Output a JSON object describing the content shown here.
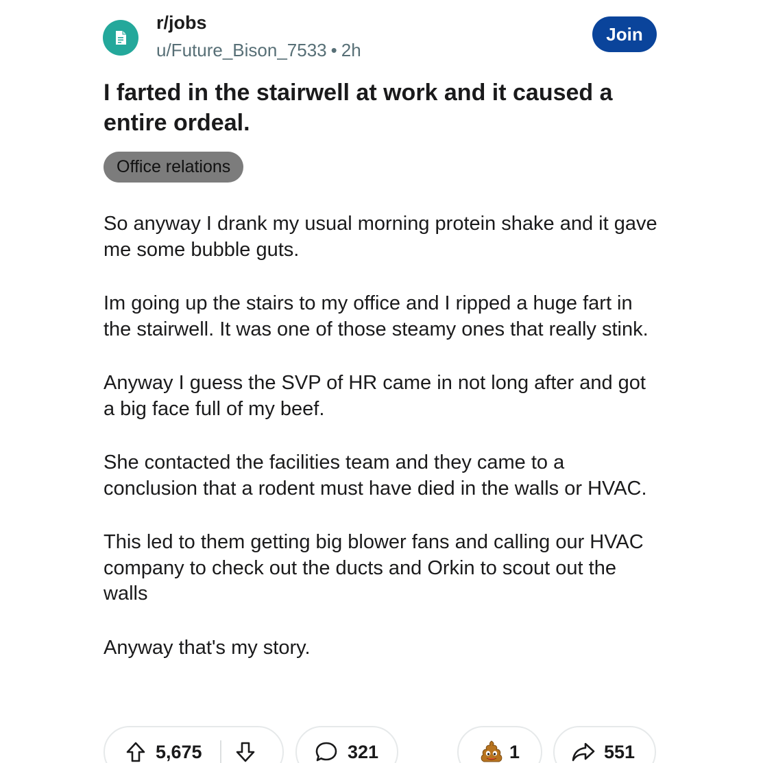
{
  "post": {
    "subreddit": "r/jobs",
    "author": "u/Future_Bison_7533",
    "separator": "•",
    "age": "2h",
    "join_label": "Join",
    "title": "I farted in the stairwell at work and it caused a entire ordeal.",
    "flair": "Office relations",
    "paragraphs": [
      "So anyway I drank my usual morning protein shake and it gave me some bubble guts.",
      "Im going up the stairs to my office and I ripped a huge fart in the stairwell. It was one of those steamy ones that really stink.",
      "Anyway I guess the SVP of HR came in not long after and got a big face full of my beef.",
      "She contacted the facilities team and they came to a conclusion that a rodent must have died in the walls or HVAC.",
      "This led to them getting big blower fans and calling our HVAC company to check out the ducts and Orkin to scout out the walls",
      "Anyway that's my story."
    ]
  },
  "actions": {
    "upvotes": "5,675",
    "comments": "321",
    "awards": "1",
    "shares": "551"
  },
  "icons": {
    "avatar": "subreddit-document-icon",
    "upvote": "upvote-arrow-icon",
    "downvote": "downvote-arrow-icon",
    "comment": "comment-bubble-icon",
    "award": "poop-award-icon",
    "share": "share-arrow-icon"
  },
  "colors": {
    "avatar_bg": "#24a89b",
    "join_bg": "#0a449b",
    "flair_bg": "#7c7c7c",
    "meta_text": "#576f76"
  }
}
